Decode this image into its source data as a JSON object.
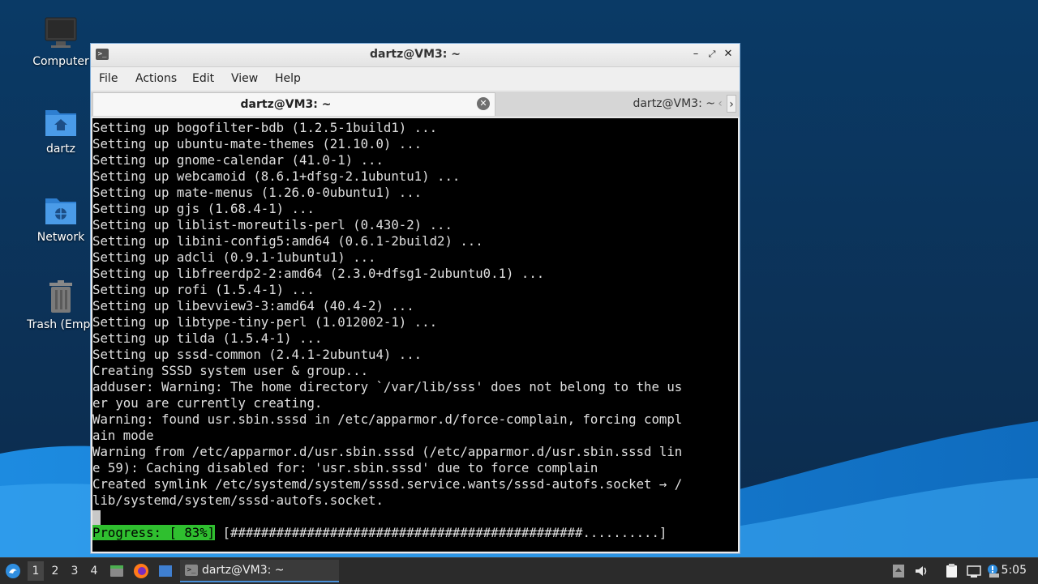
{
  "desktop": {
    "icons": [
      {
        "label": "Computer",
        "icon": "computer-icon"
      },
      {
        "label": "dartz",
        "icon": "home-folder-icon"
      },
      {
        "label": "Network",
        "icon": "network-folder-icon"
      },
      {
        "label": "Trash (Empt",
        "icon": "trash-icon"
      }
    ]
  },
  "window": {
    "title": "dartz@VM3: ~",
    "menu": [
      "File",
      "Actions",
      "Edit",
      "View",
      "Help"
    ],
    "tabs": [
      {
        "label": "dartz@VM3: ~",
        "active": true
      },
      {
        "label": "dartz@VM3: ~",
        "active": false
      }
    ]
  },
  "terminal": {
    "lines": [
      "Setting up bogofilter-bdb (1.2.5-1build1) ...",
      "Setting up ubuntu-mate-themes (21.10.0) ...",
      "Setting up gnome-calendar (41.0-1) ...",
      "Setting up webcamoid (8.6.1+dfsg-2.1ubuntu1) ...",
      "Setting up mate-menus (1.26.0-0ubuntu1) ...",
      "Setting up gjs (1.68.4-1) ...",
      "Setting up liblist-moreutils-perl (0.430-2) ...",
      "Setting up libini-config5:amd64 (0.6.1-2build2) ...",
      "Setting up adcli (0.9.1-1ubuntu1) ...",
      "Setting up libfreerdp2-2:amd64 (2.3.0+dfsg1-2ubuntu0.1) ...",
      "Setting up rofi (1.5.4-1) ...",
      "Setting up libevview3-3:amd64 (40.4-2) ...",
      "Setting up libtype-tiny-perl (1.012002-1) ...",
      "Setting up tilda (1.5.4-1) ...",
      "Setting up sssd-common (2.4.1-2ubuntu4) ...",
      "Creating SSSD system user & group...",
      "adduser: Warning: The home directory `/var/lib/sss' does not belong to the us",
      "er you are currently creating.",
      "Warning: found usr.sbin.sssd in /etc/apparmor.d/force-complain, forcing compl",
      "ain mode",
      "Warning from /etc/apparmor.d/usr.sbin.sssd (/etc/apparmor.d/usr.sbin.sssd lin",
      "e 59): Caching disabled for: 'usr.sbin.sssd' due to force complain",
      "Created symlink /etc/systemd/system/sssd.service.wants/sssd-autofs.socket → /",
      "lib/systemd/system/sssd-autofs.socket."
    ],
    "progress_label": "Progress: [ 83%]",
    "progress_bar": " [##############################################..........]",
    "progress_percent": 83
  },
  "taskbar": {
    "workspaces": [
      "1",
      "2",
      "3",
      "4"
    ],
    "active_workspace": "1",
    "task_label": "dartz@VM3: ~",
    "clock": "5:05"
  }
}
